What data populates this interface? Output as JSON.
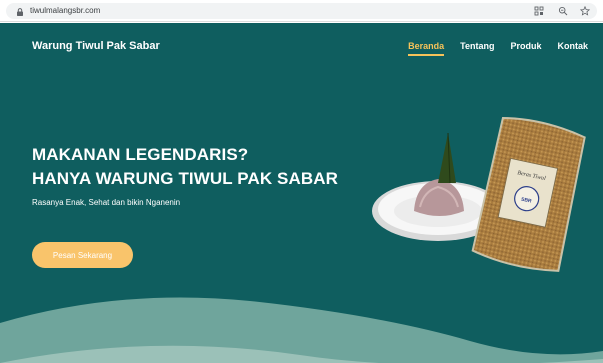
{
  "browser": {
    "url": "tiwulmalangsbr.com",
    "icons": [
      "lock-icon",
      "qr-icon",
      "zoom-icon",
      "star-icon"
    ]
  },
  "header": {
    "brand": "Warung Tiwul Pak Sabar",
    "nav": [
      {
        "label": "Beranda",
        "active": true
      },
      {
        "label": "Tentang",
        "active": false
      },
      {
        "label": "Produk",
        "active": false
      },
      {
        "label": "Kontak",
        "active": false
      }
    ]
  },
  "hero": {
    "title_line1": "MAKANAN LEGENDARIS?",
    "title_line2": "HANYA WARUNG TIWUL PAK SABAR",
    "subtitle": "Rasanya Enak, Sehat dan bikin Nganenin",
    "cta_label": "Pesan Sekarang",
    "bag_label": "Beras Tiwul",
    "bag_badge": "SBR"
  },
  "colors": {
    "background": "#0f5e5f",
    "accent": "#f6c35a",
    "button": "#f9c46b",
    "wave": "#6fa59c"
  }
}
